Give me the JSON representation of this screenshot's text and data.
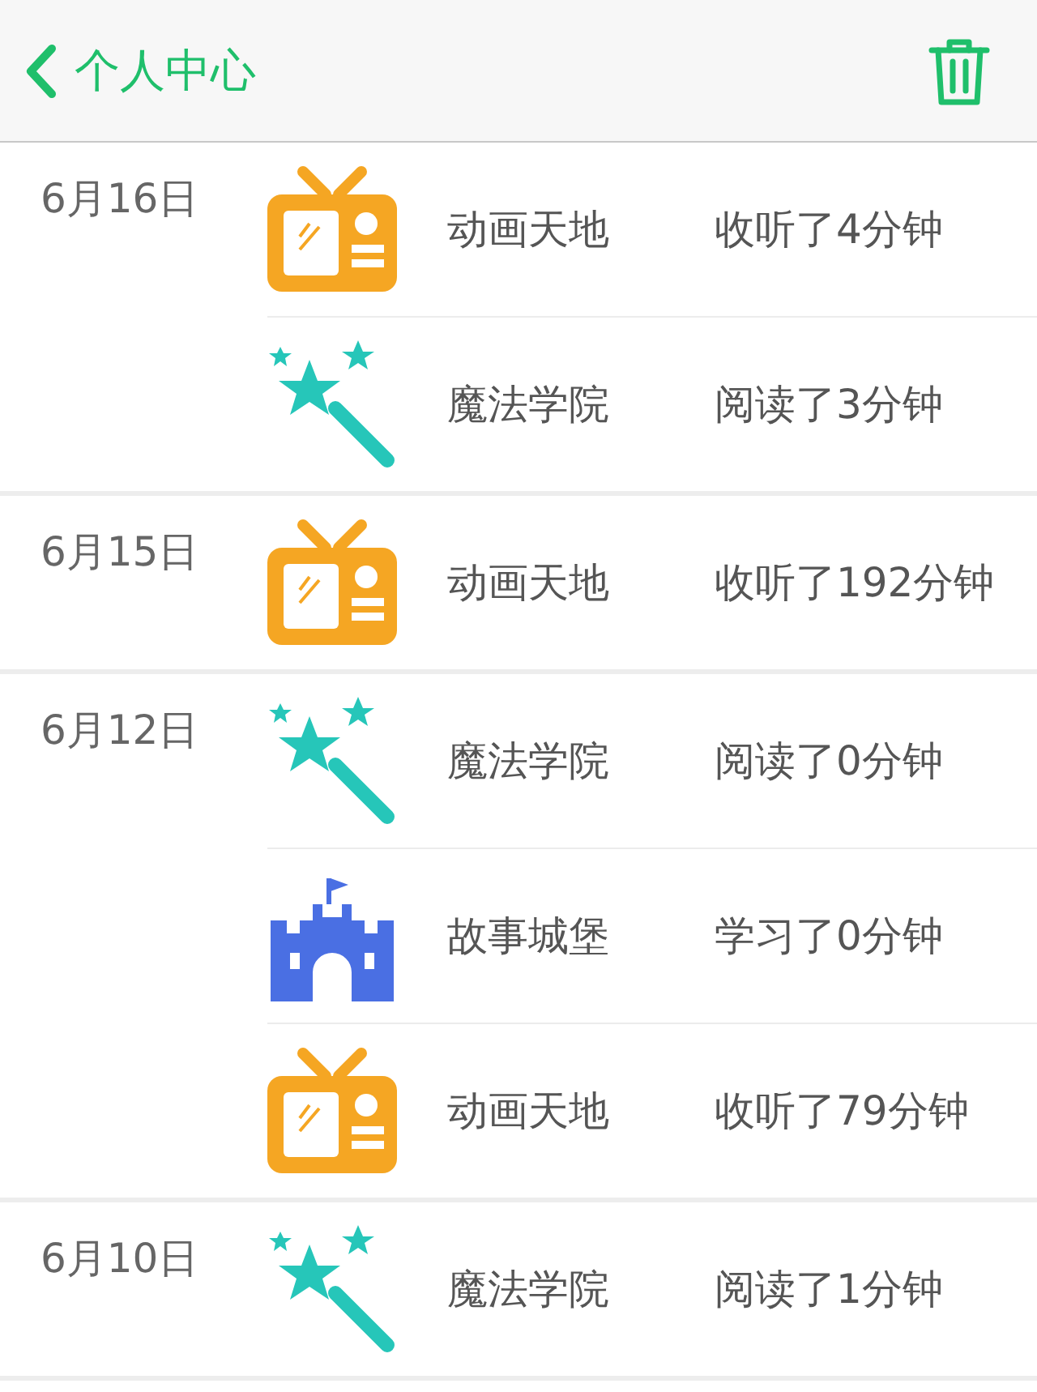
{
  "header": {
    "title": "个人中心"
  },
  "groups": [
    {
      "date": "6月16日",
      "entries": [
        {
          "kind": "tv",
          "name": "动画天地",
          "activity": "收听了4分钟"
        },
        {
          "kind": "wand",
          "name": "魔法学院",
          "activity": "阅读了3分钟"
        }
      ]
    },
    {
      "date": "6月15日",
      "entries": [
        {
          "kind": "tv",
          "name": "动画天地",
          "activity": "收听了192分钟"
        }
      ]
    },
    {
      "date": "6月12日",
      "entries": [
        {
          "kind": "wand",
          "name": "魔法学院",
          "activity": "阅读了0分钟"
        },
        {
          "kind": "castle",
          "name": "故事城堡",
          "activity": "学习了0分钟"
        },
        {
          "kind": "tv",
          "name": "动画天地",
          "activity": "收听了79分钟"
        }
      ]
    },
    {
      "date": "6月10日",
      "entries": [
        {
          "kind": "wand",
          "name": "魔法学院",
          "activity": "阅读了1分钟"
        }
      ]
    }
  ]
}
